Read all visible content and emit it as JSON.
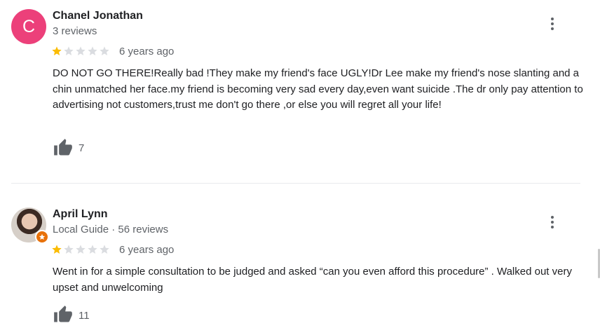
{
  "reviews": [
    {
      "avatar_letter": "C",
      "avatar_color": "#ec407a",
      "name": "Chanel Jonathan",
      "meta": "3 reviews",
      "rating": 1,
      "max_rating": 5,
      "time": "6 years ago",
      "text": "DO NOT GO THERE!Really bad !They make my friend's face UGLY!Dr Lee make my friend's nose slanting and a chin unmatched her face.my friend is becoming very sad every day,even want suicide .The dr only pay attention to advertising not customers,trust me don't go there ,or else you will regret all your life!",
      "likes": "7"
    },
    {
      "name": "April Lynn",
      "meta": "Local Guide · 56 reviews",
      "local_guide": true,
      "rating": 1,
      "max_rating": 5,
      "time": "6 years ago",
      "text": "Went in for a simple consultation to be judged and asked “can you even afford this procedure” . Walked out very upset and unwelcoming",
      "likes": "11"
    }
  ],
  "colors": {
    "star_filled": "#fbbc04",
    "star_empty": "#dadce0",
    "local_guide_badge": "#e8710a"
  },
  "icons": {
    "star": "star-icon",
    "thumbs_up": "thumbs-up-icon",
    "more": "more-vert-icon"
  }
}
